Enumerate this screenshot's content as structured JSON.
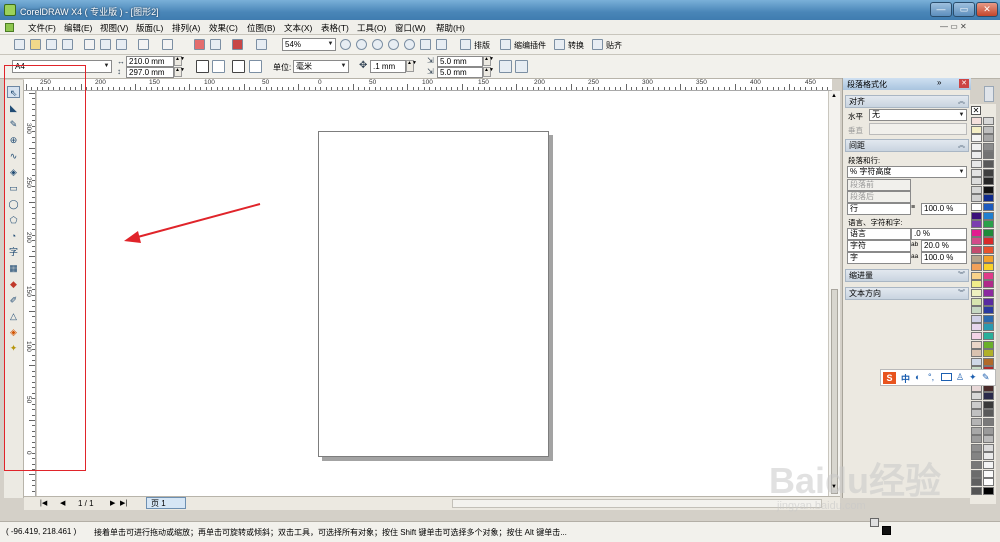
{
  "window": {
    "title": "CorelDRAW X4 ( 专业版 ) - [图形2]",
    "controls": [
      "—",
      "▭",
      "✕"
    ]
  },
  "menu": [
    "文件(F)",
    "编辑(E)",
    "视图(V)",
    "版面(L)",
    "排列(A)",
    "效果(C)",
    "位图(B)",
    "文本(X)",
    "表格(T)",
    "工具(O)",
    "窗口(W)",
    "帮助(H)"
  ],
  "toolbar": {
    "zoom": "54%",
    "labels": {
      "layout": "排版",
      "plugins": "缩编插件",
      "convert": "转换",
      "paste": "贴齐"
    }
  },
  "property_bar": {
    "page_preset": "A4",
    "width": "210.0 mm",
    "height": "297.0 mm",
    "unit_label": "单位:",
    "unit_value": "毫米",
    "nudge": ".1 mm",
    "dup_x": "5.0 mm",
    "dup_y": "5.0 mm"
  },
  "ruler": {
    "h_labels": [
      "250",
      "200",
      "150",
      "100",
      "50",
      "0",
      "50",
      "100",
      "150",
      "200",
      "250",
      "300",
      "350",
      "400",
      "450"
    ],
    "v_labels": [
      "300",
      "250",
      "200",
      "150",
      "100",
      "50",
      "0"
    ]
  },
  "page_nav": {
    "counter": "1 / 1",
    "tab": "页 1"
  },
  "status": {
    "coords": "( -96.419, 218.461 )",
    "hint": "接着单击可进行拖动或缩放；再单击可旋转或倾斜；双击工具，可选择所有对象；按住 Shift 键单击可选择多个对象；按住 Alt 键单击..."
  },
  "docker": {
    "title": "段落格式化",
    "align": {
      "header": "对齐",
      "horizontal_label": "水平",
      "horizontal_value": "无",
      "vertical_label": "垂直"
    },
    "spacing": {
      "header": "间距",
      "para_line_label": "段落和行:",
      "mode": "% 字符高度",
      "before_label": "段落前",
      "after_label": "段落后",
      "line_label": "行",
      "line_value": "100.0 %",
      "lang_label": "语言、字符和字:",
      "language_label": "语言",
      "language_value": ".0 %",
      "char_label": "字符",
      "char_value": "20.0 %",
      "word_label": "字",
      "word_value": "100.0 %"
    },
    "indent_header": "缩进量",
    "direction_header": "文本方向"
  },
  "ime_bar": {
    "logo": "S",
    "lang": "中"
  },
  "watermark": {
    "brand": "Baidu经验",
    "url": "jingyan.baidu.com"
  },
  "colors": {
    "accent_red": "#e0242a",
    "title_blue": "#4a86b8"
  }
}
